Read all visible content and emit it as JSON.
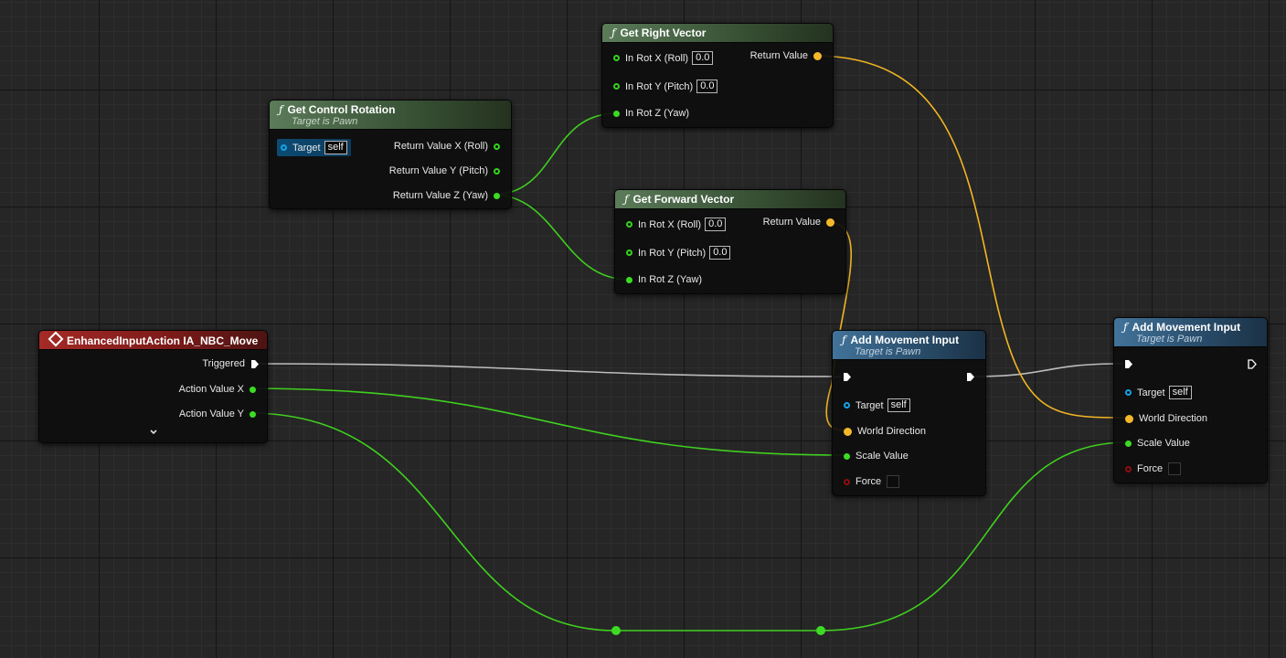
{
  "colors": {
    "exec_wire": "#bdbdbd",
    "float_wire": "#3fcf1f",
    "vector_wire": "#f3b623",
    "object_pin": "#14a3e6"
  },
  "nodes": {
    "event": {
      "title": "EnhancedInputAction IA_NBC_Move",
      "icon": "event-diamond-icon",
      "pins": {
        "triggered": "Triggered",
        "action_x": "Action Value X",
        "action_y": "Action Value Y"
      },
      "expand_icon": "chevron-down-icon"
    },
    "control_rotation": {
      "title": "Get Control Rotation",
      "subtitle": "Target is Pawn",
      "pins": {
        "target": "Target",
        "target_value": "self",
        "ret_x": "Return Value X (Roll)",
        "ret_y": "Return Value Y (Pitch)",
        "ret_z": "Return Value Z (Yaw)"
      }
    },
    "right_vector": {
      "title": "Get Right Vector",
      "pins": {
        "rot_x": "In Rot X (Roll)",
        "rot_x_value": "0.0",
        "rot_y": "In Rot Y (Pitch)",
        "rot_y_value": "0.0",
        "rot_z": "In Rot Z (Yaw)",
        "ret": "Return Value"
      }
    },
    "forward_vector": {
      "title": "Get Forward Vector",
      "pins": {
        "rot_x": "In Rot X (Roll)",
        "rot_x_value": "0.0",
        "rot_y": "In Rot Y (Pitch)",
        "rot_y_value": "0.0",
        "rot_z": "In Rot Z (Yaw)",
        "ret": "Return Value"
      }
    },
    "add_movement_1": {
      "title": "Add Movement Input",
      "subtitle": "Target is Pawn",
      "pins": {
        "target": "Target",
        "target_value": "self",
        "world_dir": "World Direction",
        "scale": "Scale Value",
        "force": "Force"
      }
    },
    "add_movement_2": {
      "title": "Add Movement Input",
      "subtitle": "Target is Pawn",
      "pins": {
        "target": "Target",
        "target_value": "self",
        "world_dir": "World Direction",
        "scale": "Scale Value",
        "force": "Force"
      }
    }
  }
}
